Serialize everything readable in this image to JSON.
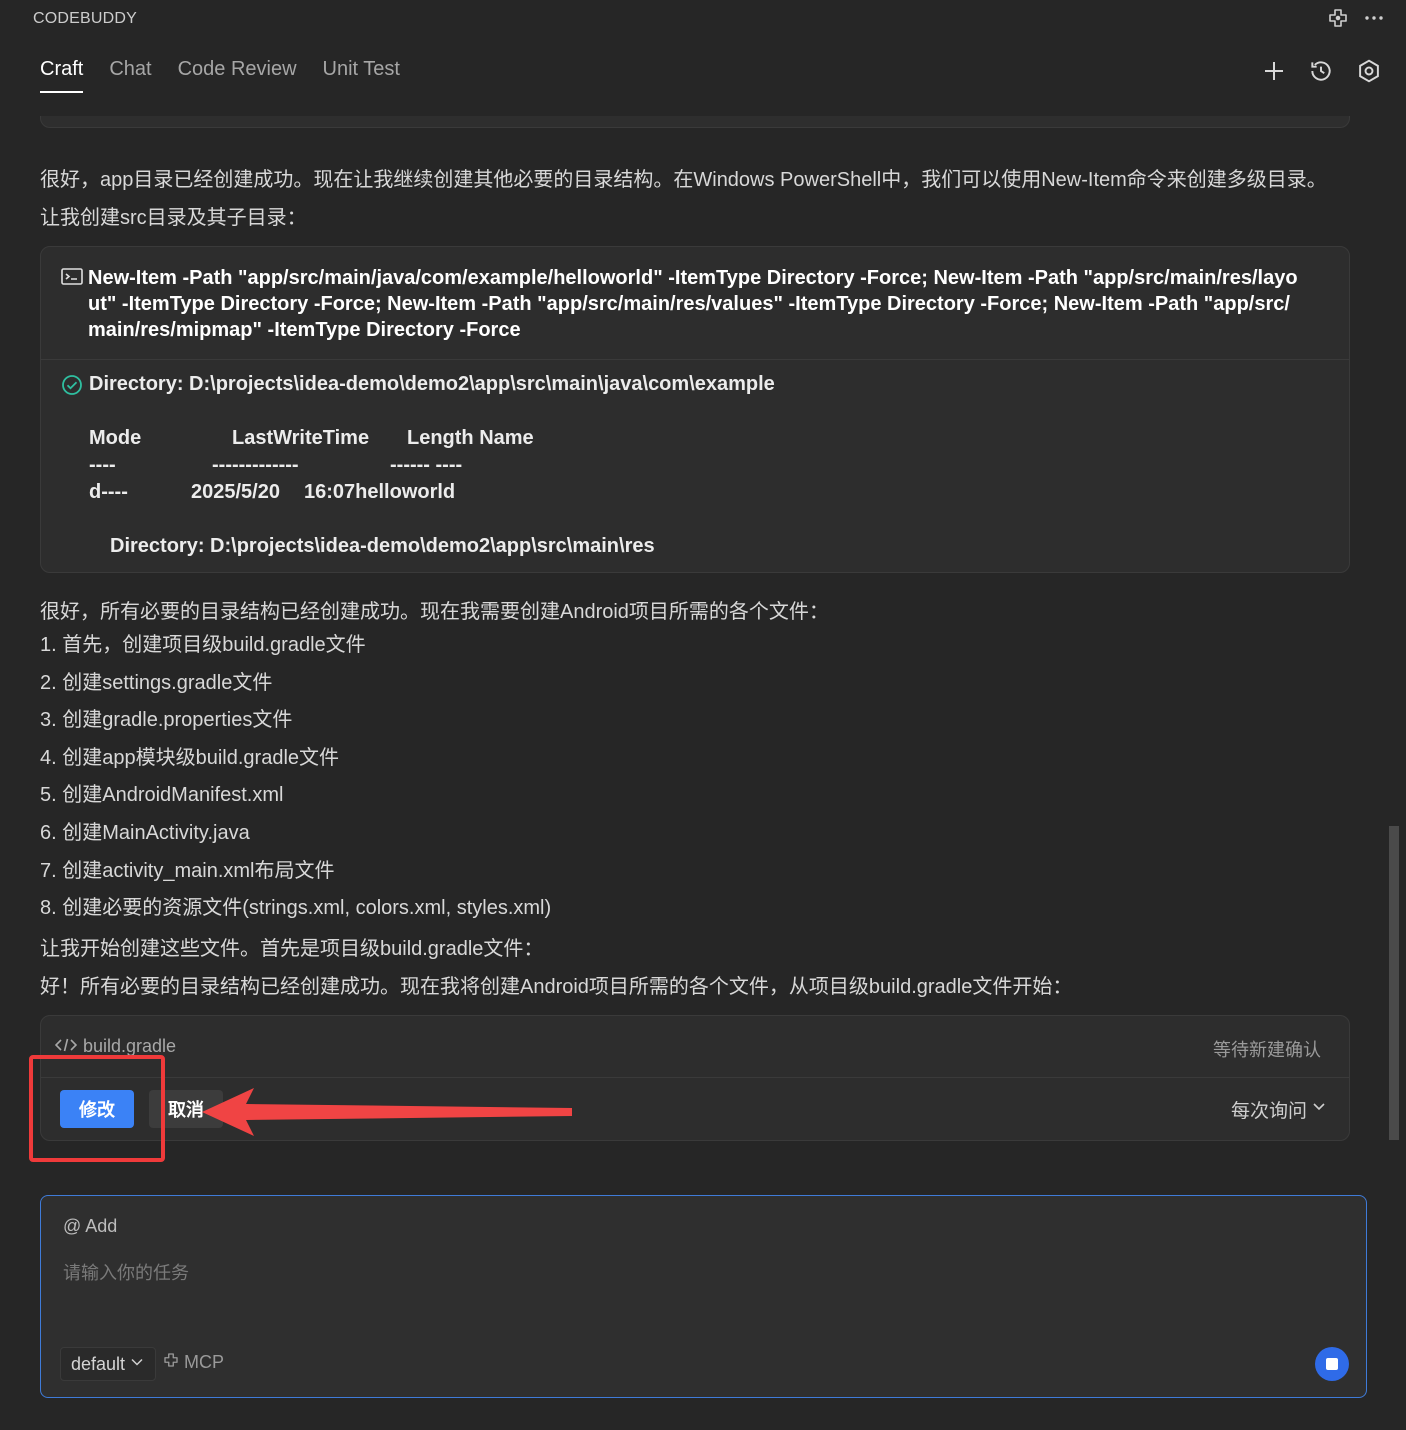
{
  "app": {
    "title": "CODEBUDDY"
  },
  "header": {
    "icons": [
      "mcp-icon",
      "more-icon"
    ]
  },
  "tabs": [
    {
      "label": "Craft",
      "active": true
    },
    {
      "label": "Chat",
      "active": false
    },
    {
      "label": "Code Review",
      "active": false
    },
    {
      "label": "Unit Test",
      "active": false
    }
  ],
  "tab_actions": [
    "plus-icon",
    "history-icon",
    "settings-icon"
  ],
  "messages": {
    "intro_line1": "很好，app目录已经创建成功。现在让我继续创建其他必要的目录结构。在Windows PowerShell中，我们可以使用New-Item命令来创建多级目录。",
    "intro_line2": "让我创建src目录及其子目录：",
    "command": "New-Item -Path \"app/src/main/java/com/example/helloworld\" -ItemType Directory -Force; New-Item -Path \"app/src/main/res/layout\" -ItemType Directory -Force; New-Item -Path \"app/src/main/res/values\" -ItemType Directory -Force; New-Item -Path \"app/src/main/res/mipmap\" -ItemType Directory -Force",
    "output": {
      "directory1": "Directory: D:\\projects\\idea-demo\\demo2\\app\\src\\main\\java\\com\\example",
      "col_mode": "Mode",
      "col_lastwrite": "LastWriteTime",
      "col_length_name": "Length Name",
      "dash_mode": "----",
      "dash_lastwrite": "-------------",
      "dash_length_name": "------ ----",
      "row_mode": "d----",
      "row_date": "2025/5/20",
      "row_time_name": "16:07helloworld",
      "directory2": "Directory: D:\\projects\\idea-demo\\demo2\\app\\src\\main\\res"
    },
    "plan_intro": "很好，所有必要的目录结构已经创建成功。现在我需要创建Android项目所需的各个文件：",
    "plan_items": [
      "1. 首先，创建项目级build.gradle文件",
      "2. 创建settings.gradle文件",
      "3. 创建gradle.properties文件",
      "4. 创建app模块级build.gradle文件",
      "5. 创建AndroidManifest.xml",
      "6. 创建MainActivity.java",
      "7. 创建activity_main.xml布局文件",
      "8. 创建必要的资源文件(strings.xml, colors.xml, styles.xml)"
    ],
    "plan_next": "让我开始创建这些文件。首先是项目级build.gradle文件：",
    "plan_confirm": "好！所有必要的目录结构已经创建成功。现在我将创建Android项目所需的各个文件，从项目级build.gradle文件开始："
  },
  "file_card": {
    "filename": "build.gradle",
    "status": "等待新建确认",
    "confirm_label": "修改",
    "cancel_label": "取消",
    "ask_label": "每次询问"
  },
  "composer": {
    "add_label": "@ Add",
    "placeholder": "请输入你的任务",
    "mode": "default",
    "mcp_label": "MCP"
  },
  "colors": {
    "background": "#262626",
    "accent": "#3b82f6",
    "annotation": "#ef3a3a",
    "success": "#2fbfa0"
  }
}
